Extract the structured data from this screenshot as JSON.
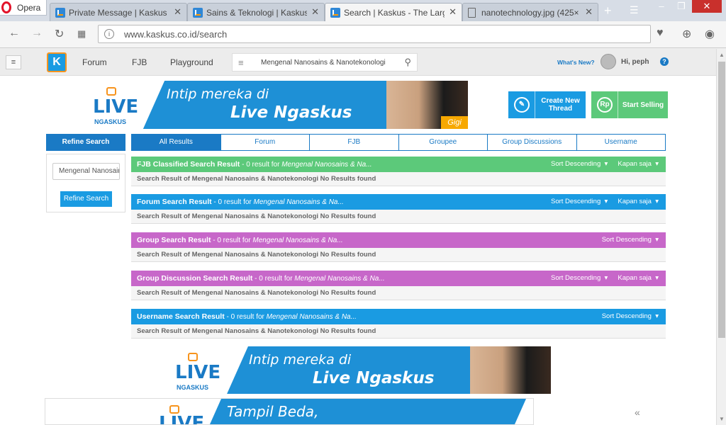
{
  "browser": {
    "opera_label": "Opera",
    "tabs": [
      {
        "title": "Private Message | Kaskus - ",
        "icon": "kaskus-favicon"
      },
      {
        "title": "Sains & Teknologi | Kaskus",
        "icon": "kaskus-favicon"
      },
      {
        "title": "Search | Kaskus - The Large",
        "icon": "kaskus-favicon"
      },
      {
        "title": "nanotechnology.jpg (425×",
        "icon": "document-icon"
      }
    ],
    "new_tab": "+",
    "url": "www.kaskus.co.id/search"
  },
  "header": {
    "menu": [
      "Forum",
      "FJB",
      "Playground"
    ],
    "search_value": "Mengenal Nanosains & Nanotekonologi",
    "whats_new": "What's New?",
    "greeting": "Hi, peph",
    "help": "?"
  },
  "banner": {
    "live": "LIVE",
    "ngaskus": "NGASKUS",
    "line1": "Intip mereka di",
    "line2": "Live Ngaskus",
    "name": "Gigi"
  },
  "banner_bottom": {
    "line1": "Tampil Beda,"
  },
  "actions": {
    "create": "Create New Thread",
    "sell": "Start Selling",
    "sell_icon": "Rp"
  },
  "sidebar": {
    "heading": "Refine Search",
    "input_value": "Mengenal Nanosains",
    "button": "Refine Search"
  },
  "tabs": [
    "All Results",
    "Forum",
    "FJB",
    "Groupee",
    "Group Discussions",
    "Username"
  ],
  "results": [
    {
      "title": "FJB Classified Search Result",
      "count": " - 0 result for ",
      "query": "Mengenal Nanosains & Na...",
      "sort": "Sort Descending",
      "time": "Kapan saja",
      "message": "Search Result of Mengenal Nanosains & Nanotekonologi No Results found",
      "color": "#5cc97a"
    },
    {
      "title": "Forum Search Result",
      "count": " - 0 result for ",
      "query": "Mengenal Nanosains & Na...",
      "sort": "Sort Descending",
      "time": "Kapan saja",
      "message": "Search Result of Mengenal Nanosains & Nanotekonologi No Results found",
      "color": "#1a9be2"
    },
    {
      "title": "Group Search Result",
      "count": " - 0 result for ",
      "query": "Mengenal Nanosains & Na...",
      "sort": "Sort Descending",
      "time": "",
      "message": "Search Result of Mengenal Nanosains & Nanotekonologi No Results found",
      "color": "#c767c9"
    },
    {
      "title": "Group Discussion Search Result",
      "count": " - 0 result for ",
      "query": "Mengenal Nanosains & Na...",
      "sort": "Sort Descending",
      "time": "Kapan saja",
      "message": "Search Result of Mengenal Nanosains & Nanotekonologi No Results found",
      "color": "#c767c9"
    },
    {
      "title": "Username Search Result",
      "count": " - 0 result for ",
      "query": "Mengenal Nanosains & Na...",
      "sort": "Sort Descending",
      "time": "",
      "message": "Search Result of Mengenal Nanosains & Nanotekonologi No Results found",
      "color": "#1a9be2"
    }
  ]
}
